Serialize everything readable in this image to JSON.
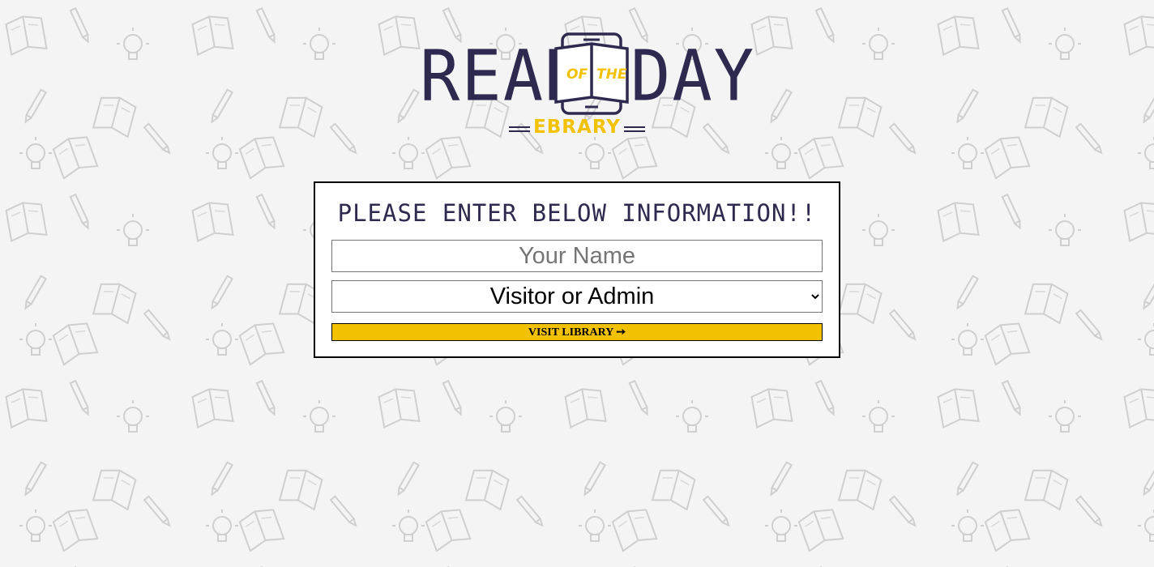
{
  "colors": {
    "brand_navy": "#2e2a4f",
    "brand_yellow": "#f2c200",
    "background": "#f4f4f4",
    "doodle": "#cfcfcf"
  },
  "background": {
    "icons": [
      "book-doodle-icon",
      "pencil-doodle-icon",
      "lightbulb-doodle-icon"
    ]
  },
  "logo": {
    "word_left": "READ",
    "word_of": "OF",
    "word_the": "THE",
    "word_right": "DAY",
    "subtitle": "EBRARY",
    "icon": "book-phone-icon"
  },
  "form": {
    "title": "Please enter below information!!",
    "name_placeholder": "Your Name",
    "name_value": "",
    "role_selected": "Visitor or Admin",
    "submit_label": "VISIT LIBRARY ➙"
  }
}
